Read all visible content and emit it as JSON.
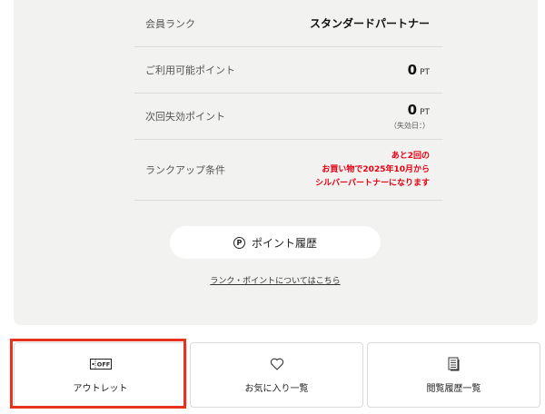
{
  "membership": {
    "rank_label": "会員ランク",
    "rank_value": "スタンダードパートナー",
    "available_points_label": "ご利用可能ポイント",
    "available_points": "0",
    "available_points_unit": "PT",
    "expiring_points_label": "次回失効ポイント",
    "expiring_points": "0",
    "expiring_points_unit": "PT",
    "expiry_date": "（失効日：）",
    "rankup_label": "ランクアップ条件",
    "rankup_line1": "あと2回の",
    "rankup_line2": "お買い物で2025年10月から",
    "rankup_line3": "シルバーパートナーになります"
  },
  "actions": {
    "point_history": "ポイント履歴",
    "point_history_icon": "P",
    "rank_info_link": "ランク・ポイントについてはこちら"
  },
  "cards": [
    {
      "label": "アウトレット",
      "icon": "off-tag-icon",
      "icon_text": "OFF"
    },
    {
      "label": "お気に入り一覧",
      "icon": "heart-icon"
    },
    {
      "label": "閲覧履歴一覧",
      "icon": "document-list-icon"
    }
  ],
  "colors": {
    "panel_bg": "#f2f2f0",
    "rankup_text": "#e60012",
    "highlight_border": "#e8331c"
  }
}
